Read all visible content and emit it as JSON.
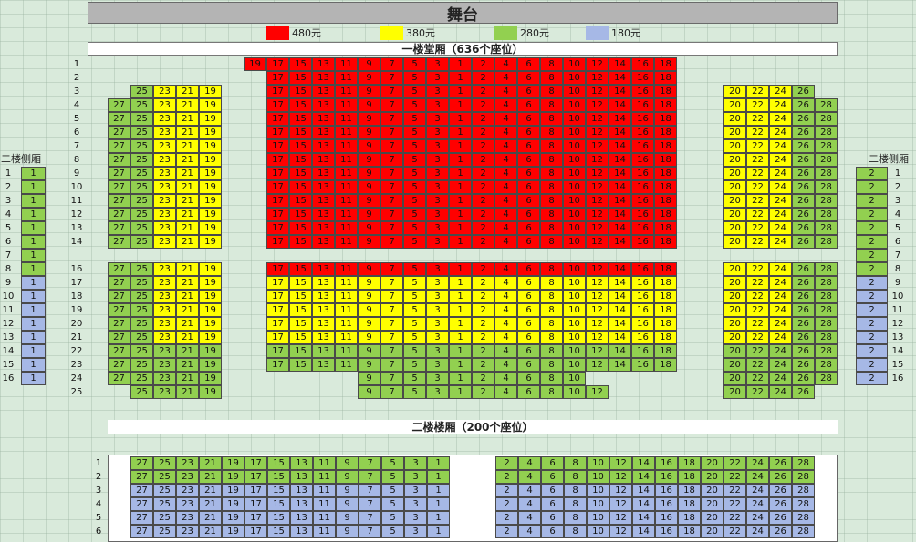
{
  "stage": "舞台",
  "legend": [
    {
      "label": "480元",
      "color": "#ff0000"
    },
    {
      "label": "380元",
      "color": "#ffff00"
    },
    {
      "label": "280元",
      "color": "#92d050"
    },
    {
      "label": "180元",
      "color": "#a6b8e6"
    }
  ],
  "floor1_title": "一楼堂厢（636个座位）",
  "floor2_title": "二楼楼厢（200个座位）",
  "side_left_title": "二楼侧厢",
  "side_right_title": "二楼侧厢",
  "colors": {
    "red": "#ff0000",
    "yellow": "#ffff00",
    "green": "#92d050",
    "blue": "#a6b8e6"
  },
  "floor1_rows": [
    "1",
    "2",
    "3",
    "4",
    "5",
    "6",
    "7",
    "8",
    "9",
    "10",
    "11",
    "12",
    "13",
    "14",
    "16",
    "17",
    "18",
    "19",
    "20",
    "21",
    "22",
    "23",
    "24",
    "25"
  ],
  "floor1_center_numbers": [
    "19",
    "17",
    "15",
    "13",
    "11",
    "9",
    "7",
    "5",
    "3",
    "1",
    "2",
    "4",
    "6",
    "8",
    "10",
    "12",
    "14",
    "16",
    "18"
  ],
  "floor1_left_numbers": [
    "27",
    "25",
    "23",
    "21",
    "19"
  ],
  "floor1_right_numbers": [
    "20",
    "22",
    "24",
    "26",
    "28"
  ],
  "floor1_center_colors": [
    "red",
    "red",
    "red",
    "red",
    "red",
    "red",
    "red",
    "red",
    "red",
    "red",
    "red",
    "red",
    "red",
    "red",
    "red",
    "yellow",
    "yellow",
    "yellow",
    "yellow",
    "yellow",
    "green",
    "green",
    "green",
    "green"
  ],
  "floor1_left_colors": [
    [
      "green",
      "yellow",
      "yellow",
      "yellow"
    ],
    [
      "green",
      "green",
      "yellow",
      "yellow",
      "yellow"
    ],
    [
      "green",
      "green",
      "yellow",
      "yellow",
      "yellow"
    ],
    [
      "green",
      "green",
      "yellow",
      "yellow",
      "yellow"
    ],
    [
      "green",
      "green",
      "yellow",
      "yellow",
      "yellow"
    ],
    [
      "green",
      "green",
      "yellow",
      "yellow",
      "yellow"
    ],
    [
      "green",
      "green",
      "yellow",
      "yellow",
      "yellow"
    ],
    [
      "green",
      "green",
      "yellow",
      "yellow",
      "yellow"
    ],
    [
      "green",
      "green",
      "yellow",
      "yellow",
      "yellow"
    ],
    [
      "green",
      "green",
      "yellow",
      "yellow",
      "yellow"
    ],
    [
      "green",
      "green",
      "yellow",
      "yellow",
      "yellow"
    ],
    [
      "green",
      "green",
      "yellow",
      "yellow",
      "yellow"
    ],
    [
      "green",
      "green",
      "yellow",
      "yellow",
      "yellow"
    ],
    [
      "green",
      "green",
      "yellow",
      "yellow",
      "yellow"
    ],
    [
      "green",
      "green",
      "yellow",
      "yellow",
      "yellow"
    ],
    [
      "green",
      "green",
      "yellow",
      "yellow",
      "yellow"
    ],
    [
      "green",
      "green",
      "yellow",
      "yellow",
      "yellow"
    ],
    [
      "green",
      "green",
      "yellow",
      "yellow",
      "yellow"
    ],
    [
      "green",
      "green",
      "green",
      "green",
      "green"
    ],
    [
      "green",
      "green",
      "green",
      "green",
      "green"
    ],
    [
      "green",
      "green",
      "green",
      "green",
      "green"
    ],
    [
      "green",
      "green",
      "green",
      "green"
    ]
  ],
  "floor1_right_colors": [
    [
      "yellow",
      "yellow",
      "yellow",
      "green"
    ],
    [
      "yellow",
      "yellow",
      "yellow",
      "green",
      "green"
    ],
    [
      "yellow",
      "yellow",
      "yellow",
      "green",
      "green"
    ],
    [
      "yellow",
      "yellow",
      "yellow",
      "green",
      "green"
    ],
    [
      "yellow",
      "yellow",
      "yellow",
      "green",
      "green"
    ],
    [
      "yellow",
      "yellow",
      "yellow",
      "green",
      "green"
    ],
    [
      "yellow",
      "yellow",
      "yellow",
      "green",
      "green"
    ],
    [
      "yellow",
      "yellow",
      "yellow",
      "green",
      "green"
    ],
    [
      "yellow",
      "yellow",
      "yellow",
      "green",
      "green"
    ],
    [
      "yellow",
      "yellow",
      "yellow",
      "green",
      "green"
    ],
    [
      "yellow",
      "yellow",
      "yellow",
      "green",
      "green"
    ],
    [
      "yellow",
      "yellow",
      "yellow",
      "green",
      "green"
    ],
    [
      "yellow",
      "yellow",
      "yellow",
      "green",
      "green"
    ],
    [
      "yellow",
      "yellow",
      "yellow",
      "green",
      "green"
    ],
    [
      "yellow",
      "yellow",
      "yellow",
      "green",
      "green"
    ],
    [
      "yellow",
      "yellow",
      "yellow",
      "green",
      "green"
    ],
    [
      "yellow",
      "yellow",
      "yellow",
      "green",
      "green"
    ],
    [
      "yellow",
      "yellow",
      "yellow",
      "green",
      "green"
    ],
    [
      "green",
      "green",
      "green",
      "green",
      "green"
    ],
    [
      "green",
      "green",
      "green",
      "green",
      "green"
    ],
    [
      "green",
      "green",
      "green",
      "green",
      "green"
    ],
    [
      "green",
      "green",
      "green",
      "green"
    ]
  ],
  "side_rows": [
    "1",
    "2",
    "3",
    "4",
    "5",
    "6",
    "7",
    "8",
    "9",
    "10",
    "11",
    "12",
    "13",
    "14",
    "15",
    "16"
  ],
  "side_left_seat": "1",
  "side_right_seat": "2",
  "side_colors": [
    "green",
    "green",
    "green",
    "green",
    "green",
    "green",
    "green",
    "green",
    "blue",
    "blue",
    "blue",
    "blue",
    "blue",
    "blue",
    "blue",
    "blue"
  ],
  "floor2_rows": [
    "1",
    "2",
    "3",
    "4",
    "5",
    "6"
  ],
  "floor2_left_numbers": [
    "27",
    "25",
    "23",
    "21",
    "19",
    "17",
    "15",
    "13",
    "11",
    "9",
    "7",
    "5",
    "3",
    "1"
  ],
  "floor2_right_numbers": [
    "2",
    "4",
    "6",
    "8",
    "10",
    "12",
    "14",
    "16",
    "18",
    "20",
    "22",
    "24",
    "26",
    "28"
  ],
  "floor2_row_colors": [
    "green",
    "green",
    "blue",
    "blue",
    "blue",
    "blue"
  ]
}
